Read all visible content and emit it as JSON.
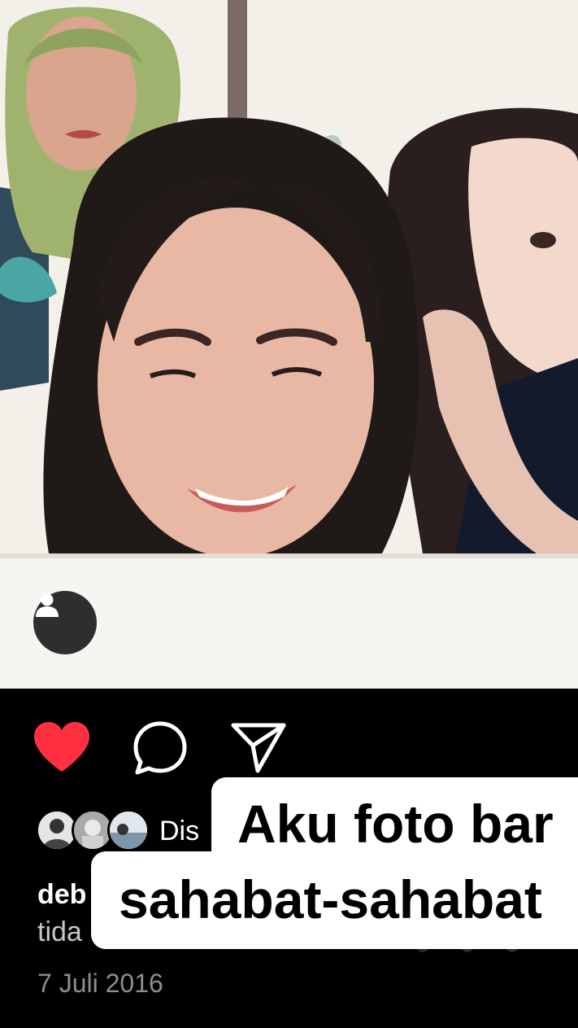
{
  "post": {
    "liked_by_prefix": "Dis",
    "caption_user": "deb",
    "caption_more": "tida",
    "date": "7 Juli 2016"
  },
  "overlay": {
    "line1": "Aku foto bar",
    "line2": "sahabat-sahabat"
  },
  "icons": {
    "tag": "person-tag-icon",
    "like": "heart-icon",
    "comment": "comment-icon",
    "share": "send-icon"
  },
  "colors": {
    "like_red": "#ff3040",
    "background": "#000000",
    "overlay_bg": "#ffffff",
    "date_gray": "#8e8e8e"
  }
}
